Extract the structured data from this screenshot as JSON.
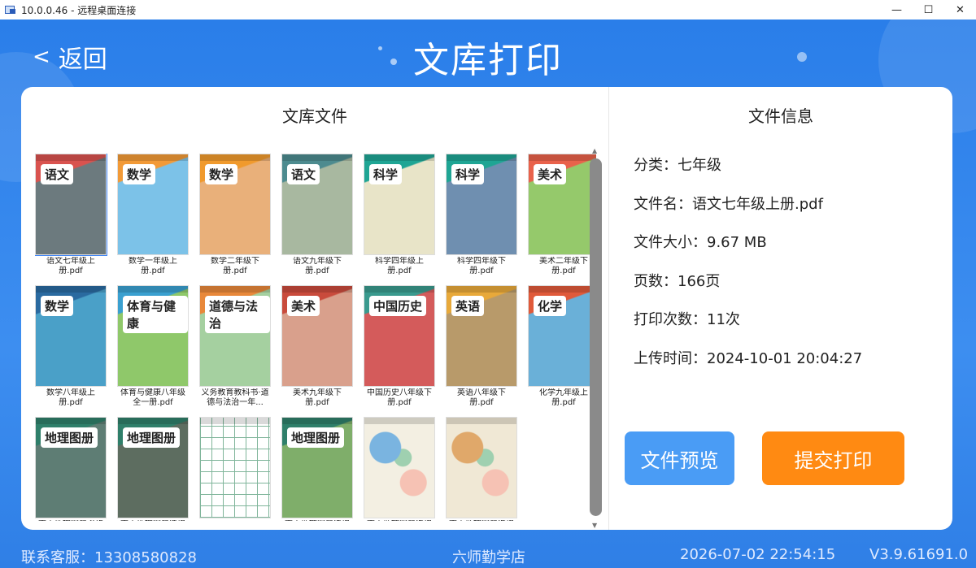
{
  "window": {
    "title": "10.0.0.46 - 远程桌面连接",
    "minimize": "—",
    "maximize": "☐",
    "close": "✕"
  },
  "header": {
    "back_label": "返回",
    "back_chevron": "<",
    "title": "文库打印"
  },
  "library": {
    "heading": "文库文件",
    "files": [
      {
        "name": "语文七年级上册.pdf",
        "cover_title": "语文",
        "color": "#6c7a7e",
        "accent": "#d9534f",
        "selected": true
      },
      {
        "name": "数学一年级上册.pdf",
        "cover_title": "数学",
        "color": "#7cc2e8",
        "accent": "#f29a37"
      },
      {
        "name": "数学二年级下册.pdf",
        "cover_title": "数学",
        "color": "#e9b07a",
        "accent": "#f09a2d"
      },
      {
        "name": "语文九年级下册.pdf",
        "cover_title": "语文",
        "color": "#a8b8a0",
        "accent": "#4d8b8f"
      },
      {
        "name": "科学四年级上册.pdf",
        "cover_title": "科学",
        "color": "#e8e4c8",
        "accent": "#1fa594"
      },
      {
        "name": "科学四年级下册.pdf",
        "cover_title": "科学",
        "color": "#6f8fb0",
        "accent": "#1fa594"
      },
      {
        "name": "美术二年级下册.pdf",
        "cover_title": "美术",
        "color": "#95c96b",
        "accent": "#e9624b"
      },
      {
        "name": "数学八年级上册.pdf",
        "cover_title": "数学",
        "color": "#4aa0c8",
        "accent": "#2a6aa0"
      },
      {
        "name": "体育与健康八年级全一册.pdf",
        "cover_title": "体育与健康",
        "color": "#8fc86a",
        "accent": "#3aa0d0"
      },
      {
        "name": "义务教育教科书·道德与法治一年...",
        "cover_title": "道德与法治",
        "color": "#a5d0a0",
        "accent": "#e8883a"
      },
      {
        "name": "美术九年级下册.pdf",
        "cover_title": "美术",
        "color": "#d9a08c",
        "accent": "#c94b3c"
      },
      {
        "name": "中国历史八年级下册.pdf",
        "cover_title": "中国历史",
        "color": "#d45b5b",
        "accent": "#3a9a8e"
      },
      {
        "name": "英语八年级下册.pdf",
        "cover_title": "英语",
        "color": "#b89a6a",
        "accent": "#e8a93a"
      },
      {
        "name": "化学九年级上册.pdf",
        "cover_title": "化学",
        "color": "#6ab0d8",
        "accent": "#e05a3a"
      },
      {
        "name": "高中地理图册必修 第...",
        "cover_title": "地理图册",
        "color": "#5e7d74",
        "accent": "#2f7f6a"
      },
      {
        "name": "高中地理图册选择性必...",
        "cover_title": "地理图册",
        "color": "#5d6d60",
        "accent": "#2f7f6a"
      },
      {
        "name": "",
        "cover_title": "",
        "color": "#ffffff",
        "accent": "#7fb59a",
        "grid": true
      },
      {
        "name": "高中地理图册选择性必...",
        "cover_title": "地理图册",
        "color": "#7fae6a",
        "accent": "#2f7f6a"
      },
      {
        "name": "高中地理图册选择性必...",
        "cover_title": "",
        "color": "#f3efe2",
        "accent": "#7ab4e0",
        "map": true
      },
      {
        "name": "高中地理图册选择性必...",
        "cover_title": "",
        "color": "#f0e8d5",
        "accent": "#e0a86a",
        "map": true
      }
    ]
  },
  "details": {
    "heading": "文件信息",
    "rows": [
      "分类：七年级",
      "文件名：语文七年级上册.pdf",
      "文件大小：9.67 MB",
      "页数：166页",
      "打印次数：11次",
      "上传时间：2024-10-01 20:04:27"
    ],
    "preview_label": "文件预览",
    "print_label": "提交打印"
  },
  "footer": {
    "contact": "联系客服：13308580828",
    "store": "六师勤学店",
    "datetime": "2026-07-02 22:54:15",
    "version": "V3.9.61691.0"
  }
}
